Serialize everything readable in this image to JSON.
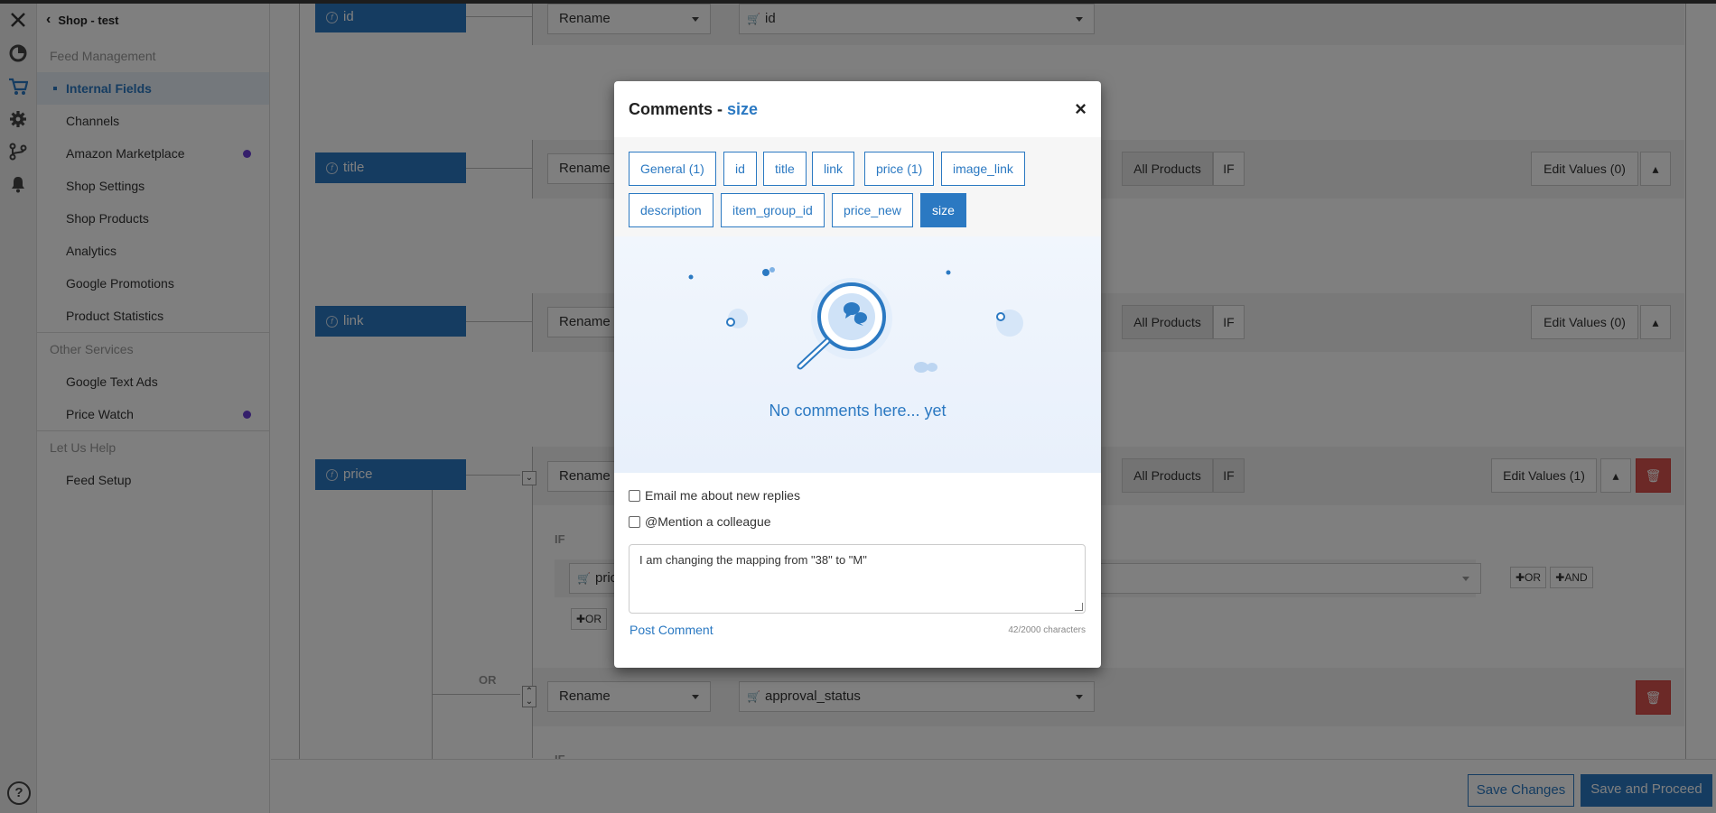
{
  "sidebar": {
    "shop_title": "Shop - test",
    "sections": [
      {
        "title": "Feed Management",
        "items": [
          {
            "label": "Internal Fields",
            "active": true
          },
          {
            "label": "Channels"
          },
          {
            "label": "Amazon Marketplace",
            "dot": true
          },
          {
            "label": "Shop Settings"
          },
          {
            "label": "Shop Products"
          },
          {
            "label": "Analytics"
          },
          {
            "label": "Google Promotions"
          },
          {
            "label": "Product Statistics"
          }
        ]
      },
      {
        "title": "Other Services",
        "items": [
          {
            "label": "Google Text Ads"
          },
          {
            "label": "Price Watch",
            "dot": true
          }
        ]
      },
      {
        "title": "Let Us Help",
        "items": [
          {
            "label": "Feed Setup"
          }
        ]
      }
    ]
  },
  "rail": {
    "icons": [
      "close-icon",
      "pie-chart-icon",
      "cart-icon",
      "gear-icon",
      "branch-icon",
      "bell-icon"
    ],
    "help": "?"
  },
  "main": {
    "fields": [
      "id",
      "title",
      "link",
      "price"
    ],
    "rename_label": "Rename",
    "id_source": "id",
    "approval_source": "approval_status",
    "all_products": "All Products",
    "if_label": "IF",
    "edit_values_0": "Edit Values (0)",
    "edit_values_1": "Edit Values (1)",
    "if_text": "IF",
    "or_text": "OR",
    "price_partial": "pric",
    "or_btn": "OR",
    "and_btn": "AND",
    "cond_or_btn": "OR",
    "if_bottom": "IF"
  },
  "bottom": {
    "save_changes": "Save Changes",
    "save_proceed": "Save and Proceed"
  },
  "modal": {
    "title_prefix": "Comments - ",
    "title_field": "size",
    "close": "×",
    "tabs_row1": [
      "General (1)",
      "id",
      "title",
      "link",
      "price (1)",
      "image_link"
    ],
    "tabs_row2": [
      "description",
      "item_group_id",
      "price_new",
      "size"
    ],
    "selected_tab": "size",
    "empty_text": "No comments here... yet",
    "email_label": "Email me about new replies",
    "mention_label": "@Mention a colleague",
    "comment_text": "I am changing the mapping from \"38\" to \"M\"",
    "post_label": "Post Comment",
    "char_count": "42/2000 characters"
  },
  "colors": {
    "accent": "#2b79c2",
    "danger": "#d9534f",
    "dot": "#6b3fd6"
  }
}
